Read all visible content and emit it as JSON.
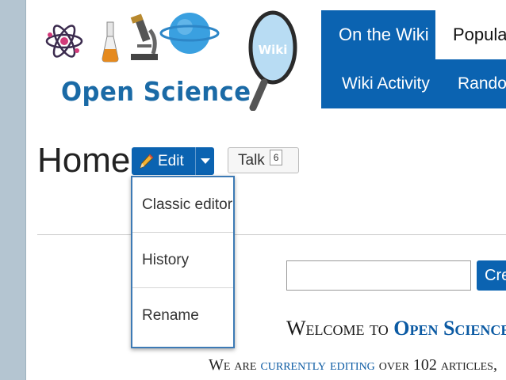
{
  "site": {
    "name": "Open Science",
    "wiki_badge": "Wiki"
  },
  "nav": {
    "tabs": [
      {
        "label": "On the Wiki"
      },
      {
        "label": "Popular"
      }
    ],
    "subitems": [
      {
        "label": "Wiki Activity"
      },
      {
        "label": "Random"
      }
    ]
  },
  "page": {
    "title": "Home"
  },
  "edit_button": {
    "label": "Edit"
  },
  "talk_button": {
    "label": "Talk",
    "count": "6"
  },
  "edit_dropdown": {
    "items": [
      {
        "label": "Classic editor"
      },
      {
        "label": "History"
      },
      {
        "label": "Rename"
      }
    ]
  },
  "create_button": {
    "label": "Cre"
  },
  "welcome": {
    "prefix": "Welcome to ",
    "site": "Open Science W"
  },
  "sub_welcome": {
    "part1": "We are ",
    "link": "currently editing",
    "part2": " over 102 articles,"
  },
  "colors": {
    "brand_blue": "#0b63b1",
    "rail": "#b4c5d1"
  }
}
